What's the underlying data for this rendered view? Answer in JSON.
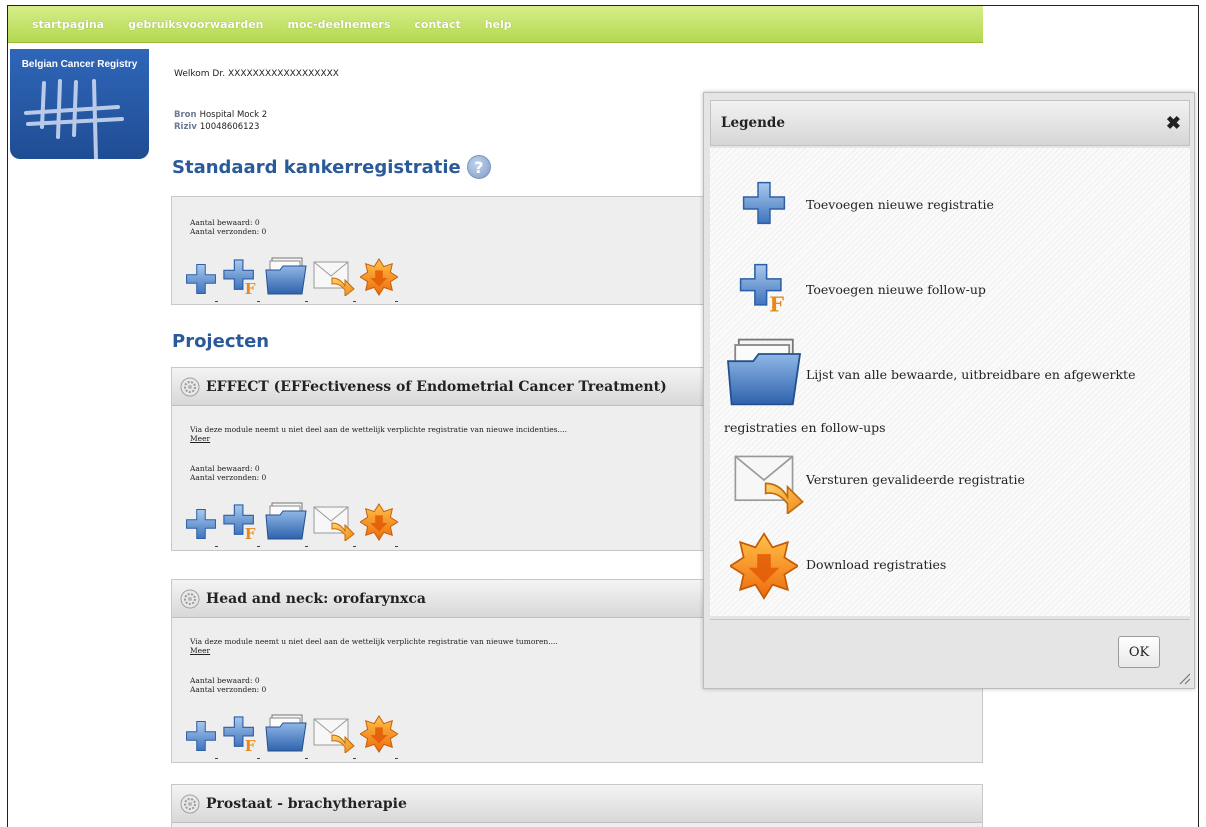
{
  "nav": {
    "items": [
      "startpagina",
      "gebruiksvoorwaarden",
      "moc-deelnemers",
      "contact",
      "help"
    ]
  },
  "logo": {
    "text": "Belgian Cancer Registry"
  },
  "welcome": {
    "label": "Welkom Dr.",
    "name": "XXXXXXXXXXXXXXXXXX"
  },
  "source": {
    "bron_label": "Bron",
    "bron_value": "Hospital Mock 2",
    "riziv_label": "Riziv",
    "riziv_value": "10048606123"
  },
  "standard": {
    "title": "Standaard kankerregistratie",
    "saved": "Aantal bewaard: 0",
    "sent": "Aantal verzonden: 0"
  },
  "projects_title": "Projecten",
  "projects": [
    {
      "title": "EFFECT (EFFectiveness of Endometrial Cancer Treatment)",
      "desc": "Via deze module neemt u niet deel aan de wettelijk verplichte registratie van nieuwe incidenties....",
      "more": "Meer",
      "saved": "Aantal bewaard: 0",
      "sent": "Aantal verzonden: 0"
    },
    {
      "title": "Head and neck: orofarynxca",
      "desc": "Via deze module neemt u niet deel aan de wettelijk verplichte registratie van nieuwe tumoren....",
      "more": "Meer",
      "saved": "Aantal bewaard: 0",
      "sent": "Aantal verzonden: 0"
    },
    {
      "title": "Prostaat - brachytherapie"
    }
  ],
  "dialog": {
    "title": "Legende",
    "ok": "OK",
    "items": [
      "Toevoegen nieuwe registratie",
      "Toevoegen nieuwe follow-up",
      "Lijst van alle bewaarde, uitbreidbare en afgewerkte",
      "registraties en follow-ups",
      "Versturen gevalideerde registratie",
      "Download registraties"
    ]
  },
  "colors": {
    "nav": "#b4d850",
    "heading": "#2a5a9a",
    "plus": "#5b8fd0",
    "star": "#f08a1a"
  }
}
